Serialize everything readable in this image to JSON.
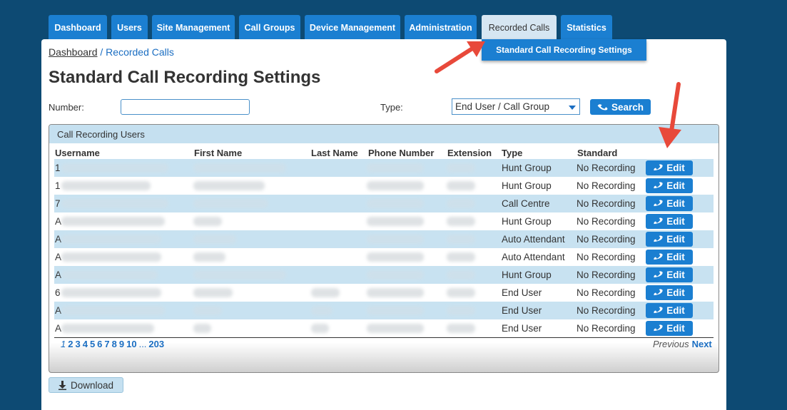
{
  "nav": {
    "tabs": [
      {
        "label": "Dashboard"
      },
      {
        "label": "Users"
      },
      {
        "label": "Site Management"
      },
      {
        "label": "Call Groups"
      },
      {
        "label": "Device Management"
      },
      {
        "label": "Administration"
      },
      {
        "label": "Recorded Calls",
        "active": true
      },
      {
        "label": "Statistics"
      }
    ],
    "dropdown_item": "Standard Call Recording Settings"
  },
  "breadcrumb": {
    "home": "Dashboard",
    "separator": " / ",
    "current": "Recorded Calls"
  },
  "page_title": "Standard Call Recording Settings",
  "filters": {
    "number_label": "Number:",
    "number_value": "",
    "type_label": "Type:",
    "type_selected": "End User / Call Group",
    "search_label": "Search"
  },
  "table": {
    "title": "Call Recording Users",
    "columns": [
      "Username",
      "First Name",
      "Last Name",
      "Phone Number",
      "Extension",
      "Type",
      "Standard"
    ],
    "rows": [
      {
        "username_initial": "1",
        "type": "Hunt Group",
        "standard": "No Recording"
      },
      {
        "username_initial": "1",
        "type": "Hunt Group",
        "standard": "No Recording"
      },
      {
        "username_initial": "7",
        "type": "Call Centre",
        "standard": "No Recording"
      },
      {
        "username_initial": "A",
        "type": "Hunt Group",
        "standard": "No Recording"
      },
      {
        "username_initial": "A",
        "type": "Auto Attendant",
        "standard": "No Recording"
      },
      {
        "username_initial": "A",
        "type": "Auto Attendant",
        "standard": "No Recording"
      },
      {
        "username_initial": "A",
        "type": "Hunt Group",
        "standard": "No Recording"
      },
      {
        "username_initial": "6",
        "type": "End User",
        "standard": "No Recording"
      },
      {
        "username_initial": "A",
        "type": "End User",
        "standard": "No Recording"
      },
      {
        "username_initial": "A",
        "type": "End User",
        "standard": "No Recording"
      }
    ],
    "edit_label": "Edit"
  },
  "pagination": {
    "current": "1",
    "pages": [
      "2",
      "3",
      "4",
      "5",
      "6",
      "7",
      "8",
      "9",
      "10"
    ],
    "ellipsis": "...",
    "last": "203",
    "previous": "Previous",
    "next": "Next"
  },
  "download_label": "Download",
  "colors": {
    "background": "#0d4a73",
    "accent": "#1b7fd1",
    "row_alt": "#c8e2f1",
    "annotation_arrow": "#e8493a"
  }
}
